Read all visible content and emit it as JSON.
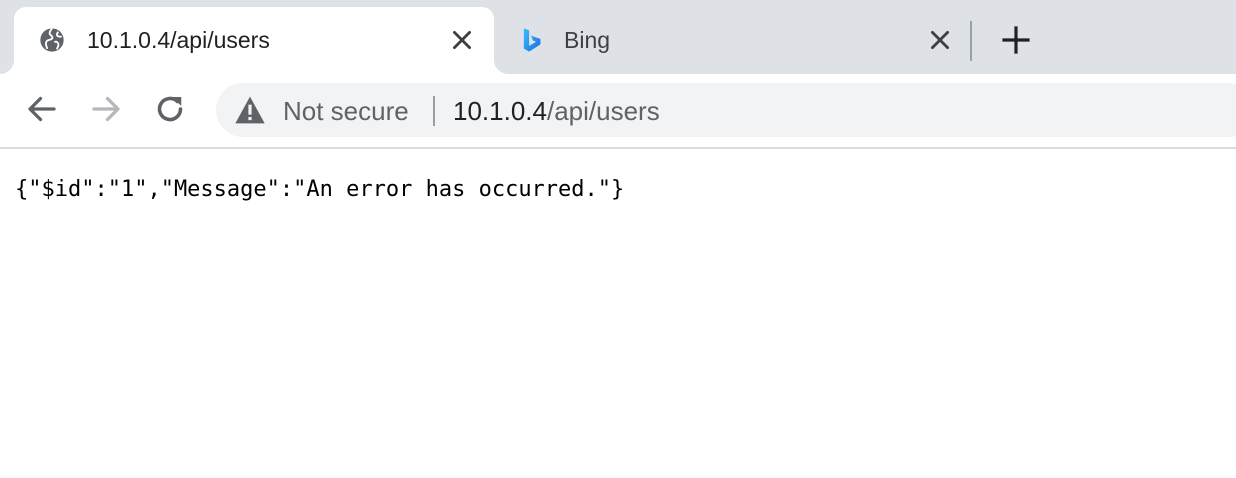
{
  "tabs": [
    {
      "title": "10.1.0.4/api/users",
      "icon": "globe-icon",
      "active": true
    },
    {
      "title": "Bing",
      "icon": "bing-logo-icon",
      "active": false
    }
  ],
  "toolbar": {
    "security_label": "Not secure",
    "url_host": "10.1.0.4",
    "url_path": "/api/users"
  },
  "page": {
    "body_text": "{\"$id\":\"1\",\"Message\":\"An error has occurred.\"}"
  },
  "colors": {
    "tabstrip_bg": "#dee1e6",
    "omnibox_bg": "#f1f3f4",
    "text_primary": "#202124",
    "text_secondary": "#5f6368",
    "bing_logo": "#1b8fe0"
  }
}
